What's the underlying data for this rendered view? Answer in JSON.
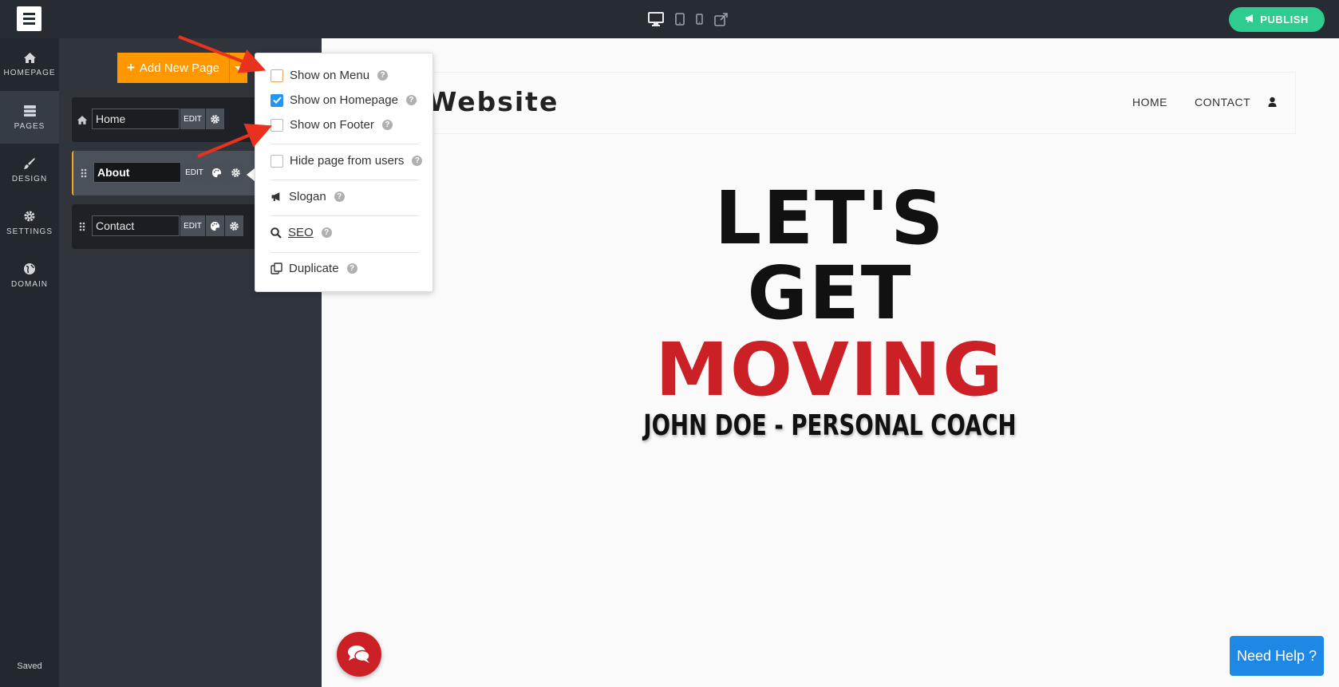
{
  "topbar": {
    "devices": [
      "desktop-icon",
      "tablet-icon",
      "mobile-icon",
      "external-link-icon"
    ],
    "publish_label": "PUBLISH"
  },
  "rail": {
    "items": [
      {
        "label": "HOMEPAGE",
        "icon": "home-icon"
      },
      {
        "label": "PAGES",
        "icon": "pages-icon"
      },
      {
        "label": "DESIGN",
        "icon": "brush-icon"
      },
      {
        "label": "SETTINGS",
        "icon": "gear-icon"
      },
      {
        "label": "DOMAIN",
        "icon": "globe-icon"
      }
    ],
    "status": "Saved"
  },
  "pages_panel": {
    "add_label": "Add New Page",
    "pages": [
      {
        "name": "Home",
        "edit": "EDIT"
      },
      {
        "name": "About",
        "edit": "EDIT"
      },
      {
        "name": "Contact",
        "edit": "EDIT"
      }
    ]
  },
  "page_menu": {
    "show_on_menu": "Show on Menu",
    "show_on_homepage": "Show on Homepage",
    "show_on_footer": "Show on Footer",
    "hide_page": "Hide page from users",
    "slogan": "Slogan",
    "seo": "SEO",
    "duplicate": "Duplicate",
    "help": "?",
    "checked": {
      "show_on_menu": false,
      "show_on_homepage": true,
      "show_on_footer": false,
      "hide_page": false
    }
  },
  "preview": {
    "site_title": "Website",
    "nav": [
      "HOME",
      "CONTACT"
    ],
    "hero_line1": "LET'S",
    "hero_line2": "GET",
    "hero_line3": "MOVING",
    "hero_sub": "JOHN DOE - PERSONAL COACH",
    "help_label": "Need Help ?"
  },
  "colors": {
    "accent_orange": "#ff9800",
    "publish_green": "#2ecc8f",
    "hero_red": "#cc2027",
    "help_blue": "#1e88e5",
    "checkbox_blue": "#2196f3",
    "annotation_red": "#e8321e"
  }
}
